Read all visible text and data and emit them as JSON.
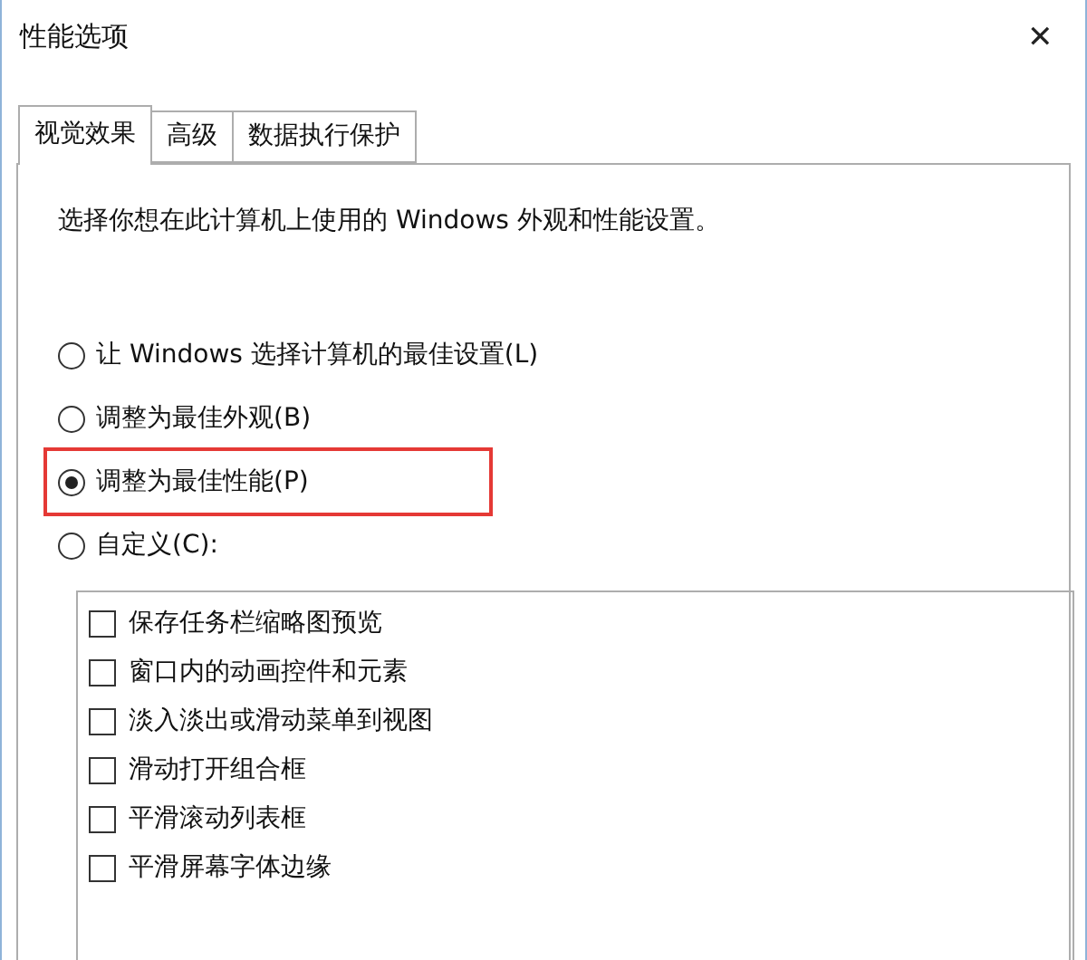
{
  "window": {
    "title": "性能选项",
    "close": "✕"
  },
  "tabs": [
    {
      "label": "视觉效果",
      "selected": true
    },
    {
      "label": "高级",
      "selected": false
    },
    {
      "label": "数据执行保护",
      "selected": false
    }
  ],
  "description": "选择你想在此计算机上使用的 Windows 外观和性能设置。",
  "options": [
    {
      "label": "让 Windows 选择计算机的最佳设置(L)",
      "selected": false,
      "highlighted": false
    },
    {
      "label": "调整为最佳外观(B)",
      "selected": false,
      "highlighted": false
    },
    {
      "label": "调整为最佳性能(P)",
      "selected": true,
      "highlighted": true
    },
    {
      "label": "自定义(C):",
      "selected": false,
      "highlighted": false
    }
  ],
  "effects": [
    {
      "label": "保存任务栏缩略图预览",
      "checked": false
    },
    {
      "label": "窗口内的动画控件和元素",
      "checked": false
    },
    {
      "label": "淡入淡出或滑动菜单到视图",
      "checked": false
    },
    {
      "label": "滑动打开组合框",
      "checked": false
    },
    {
      "label": "平滑滚动列表框",
      "checked": false
    },
    {
      "label": "平滑屏幕字体边缘",
      "checked": false
    }
  ]
}
